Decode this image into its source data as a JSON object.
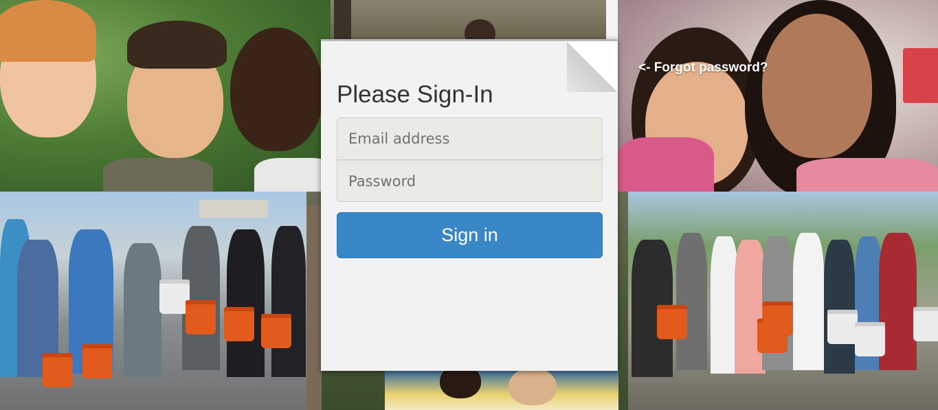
{
  "login": {
    "title": "Please Sign-In",
    "email_placeholder": "Email address",
    "password_placeholder": "Password",
    "signin_label": "Sign in",
    "forgot_label": "<- Forgot password?"
  },
  "colors": {
    "button": "#3a87c8",
    "card": "#f2f2f2",
    "input_bg": "#ebebe6"
  },
  "background": {
    "tiles": [
      "students-selfie",
      "campus-building",
      "girls-smiling",
      "cleanup-group-buckets",
      "volunteers-crowd",
      "cleanup-team-buckets"
    ]
  }
}
